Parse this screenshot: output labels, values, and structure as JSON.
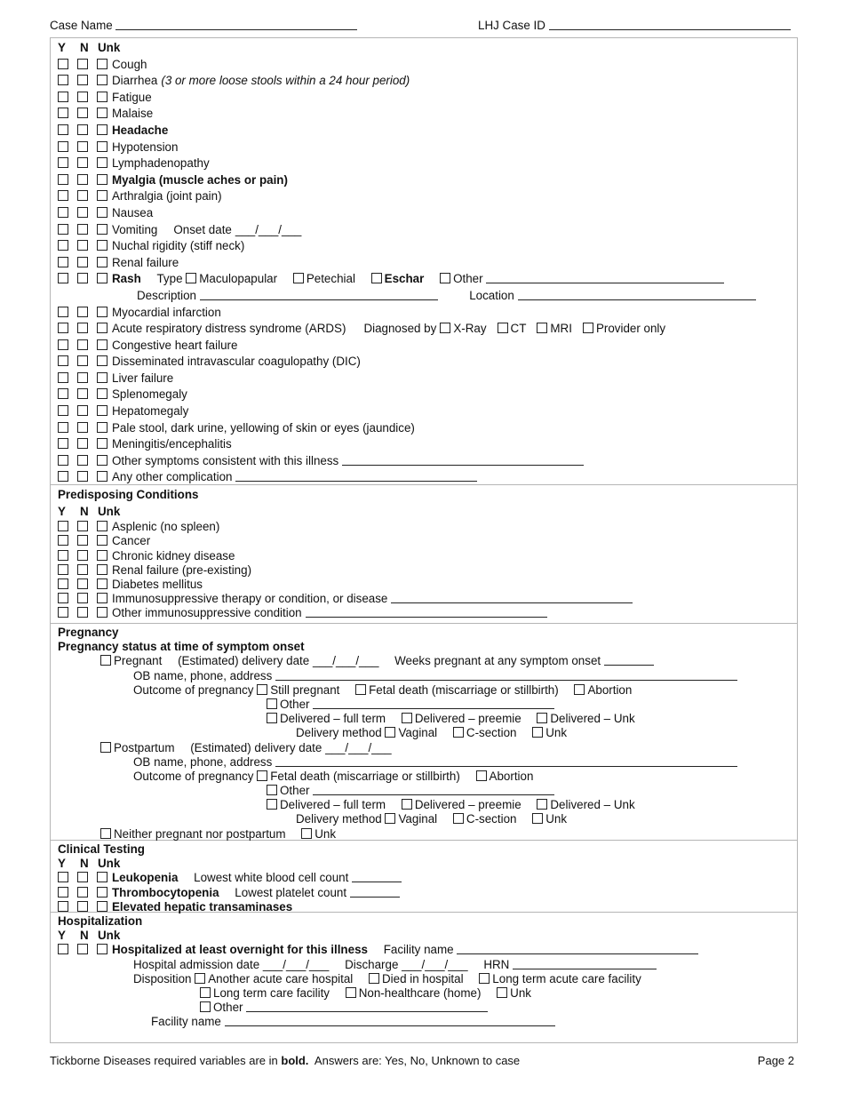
{
  "header": {
    "case_name_label": "Case Name",
    "lhj_case_id_label": "LHJ Case ID"
  },
  "ynu_header": {
    "y": "Y",
    "n": "N",
    "unk": "Unk"
  },
  "symptoms": [
    {
      "label": "Cough"
    },
    {
      "label": "Diarrhea",
      "note": "(3 or more loose stools within a 24 hour period)"
    },
    {
      "label": "Fatigue"
    },
    {
      "label": "Malaise"
    },
    {
      "label": "Headache",
      "bold": true
    },
    {
      "label": "Hypotension"
    },
    {
      "label": "Lymphadenopathy"
    },
    {
      "label": "Myalgia (muscle aches or pain)",
      "bold": true
    },
    {
      "label": "Arthralgia (joint pain)"
    },
    {
      "label": "Nausea"
    },
    {
      "label": "Vomiting",
      "extra": "Onset date",
      "date_blank": "___/___/___"
    },
    {
      "label": "Nuchal rigidity (stiff neck)"
    },
    {
      "label": "Renal failure"
    }
  ],
  "rash": {
    "label": "Rash",
    "type_label": "Type",
    "types": [
      "Maculopapular",
      "Petechial",
      "Eschar",
      "Other"
    ],
    "description_label": "Description",
    "location_label": "Location"
  },
  "symptoms2": [
    {
      "label": "Myocardial infarction"
    },
    {
      "label": "Acute respiratory distress syndrome (ARDS)"
    },
    {
      "label": "Congestive heart failure"
    },
    {
      "label": "Disseminated intravascular coagulopathy (DIC)"
    },
    {
      "label": "Liver failure"
    },
    {
      "label": "Splenomegaly"
    },
    {
      "label": "Hepatomegaly"
    },
    {
      "label": "Pale stool, dark urine, yellowing of skin or eyes (jaundice)"
    },
    {
      "label": "Meningitis/encephalitis"
    },
    {
      "label": "Other symptoms consistent with this illness"
    },
    {
      "label": "Any other complication"
    }
  ],
  "ards": {
    "diagnosed_by_label": "Diagnosed by",
    "options": [
      "X-Ray",
      "CT",
      "MRI",
      "Provider only"
    ]
  },
  "predisposing": {
    "title": "Predisposing Conditions",
    "items": [
      "Asplenic (no spleen)",
      "Cancer",
      "Chronic kidney disease",
      "Renal failure (pre-existing)",
      "Diabetes mellitus",
      "Immunosuppressive therapy or condition, or disease",
      "Other immunosuppressive condition"
    ]
  },
  "pregnancy": {
    "title": "Pregnancy",
    "subtitle": "Pregnancy status at time of symptom onset",
    "pregnant_label": "Pregnant",
    "est_delivery_label": "(Estimated) delivery date",
    "date_blank": "___/___/___",
    "weeks_label": "Weeks pregnant at any symptom onset",
    "ob_label": "OB name, phone, address",
    "outcome_label": "Outcome of pregnancy",
    "still_pregnant": "Still pregnant",
    "fetal_death": "Fetal death (miscarriage or stillbirth)",
    "abortion": "Abortion",
    "other": "Other",
    "delivered_full": "Delivered – full term",
    "delivered_preemie": "Delivered – preemie",
    "delivered_unk": "Delivered – Unk",
    "delivery_method_label": "Delivery method",
    "vaginal": "Vaginal",
    "csection": "C-section",
    "unk": "Unk",
    "postpartum_label": "Postpartum",
    "neither_label": "Neither pregnant nor postpartum"
  },
  "clinical": {
    "title": "Clinical Testing",
    "leukopenia": "Leukopenia",
    "wbc_label": "Lowest white blood cell count",
    "thrombocytopenia": "Thrombocytopenia",
    "platelet_label": "Lowest platelet count",
    "hepatic": "Elevated hepatic transaminases"
  },
  "hospitalization": {
    "title": "Hospitalization",
    "hospitalized_label": "Hospitalized at least overnight for this illness",
    "facility_label": "Facility name",
    "admission_label": "Hospital admission date",
    "date_blank": "___/___/___",
    "discharge_label": "Discharge",
    "hrn_label": "HRN",
    "disposition_label": "Disposition",
    "dispositions": [
      "Another acute care hospital",
      "Died in hospital",
      "Long term acute care facility",
      "Long term care facility",
      "Non-healthcare (home)",
      "Unk",
      "Other"
    ]
  },
  "footer": {
    "text_pre": "Tickborne Diseases required variables are in ",
    "text_bold": "bold.",
    "text_post": "  Answers are: Yes, No, Unknown to case",
    "page": "Page 2"
  }
}
